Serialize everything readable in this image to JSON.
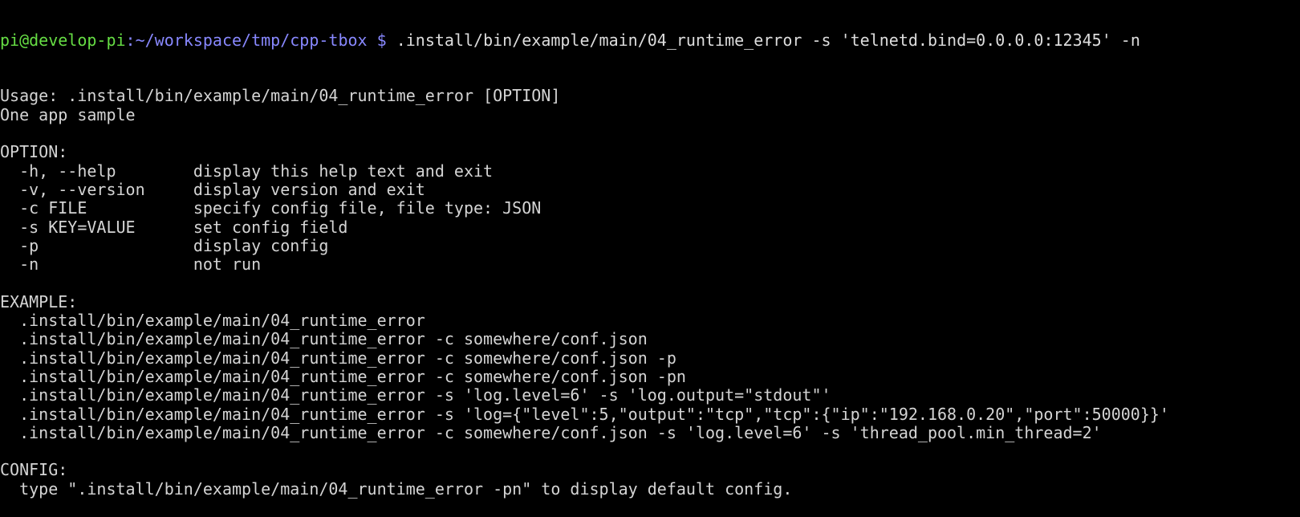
{
  "prompt": {
    "user_host": "pi@develop-pi",
    "path": ":~/workspace/tmp/cpp-tbox $",
    "command": " .install/bin/example/main/04_runtime_error -s 'telnetd.bind=0.0.0.0:12345' -n"
  },
  "lines": [
    "Usage: .install/bin/example/main/04_runtime_error [OPTION]",
    "One app sample",
    "",
    "OPTION:",
    "  -h, --help        display this help text and exit",
    "  -v, --version     display version and exit",
    "  -c FILE           specify config file, file type: JSON",
    "  -s KEY=VALUE      set config field",
    "  -p                display config",
    "  -n                not run",
    "",
    "EXAMPLE:",
    "  .install/bin/example/main/04_runtime_error",
    "  .install/bin/example/main/04_runtime_error -c somewhere/conf.json",
    "  .install/bin/example/main/04_runtime_error -c somewhere/conf.json -p",
    "  .install/bin/example/main/04_runtime_error -c somewhere/conf.json -pn",
    "  .install/bin/example/main/04_runtime_error -s 'log.level=6' -s 'log.output=\"stdout\"'",
    "  .install/bin/example/main/04_runtime_error -s 'log={\"level\":5,\"output\":\"tcp\",\"tcp\":{\"ip\":\"192.168.0.20\",\"port\":50000}}'",
    "  .install/bin/example/main/04_runtime_error -c somewhere/conf.json -s 'log.level=6' -s 'thread_pool.min_thread=2'",
    "",
    "CONFIG:",
    "  type \".install/bin/example/main/04_runtime_error -pn\" to display default config."
  ],
  "colors": {
    "background": "#000000",
    "text": "#d4d4d4",
    "prompt_user": "#66dd44",
    "prompt_path": "#8888ff"
  }
}
